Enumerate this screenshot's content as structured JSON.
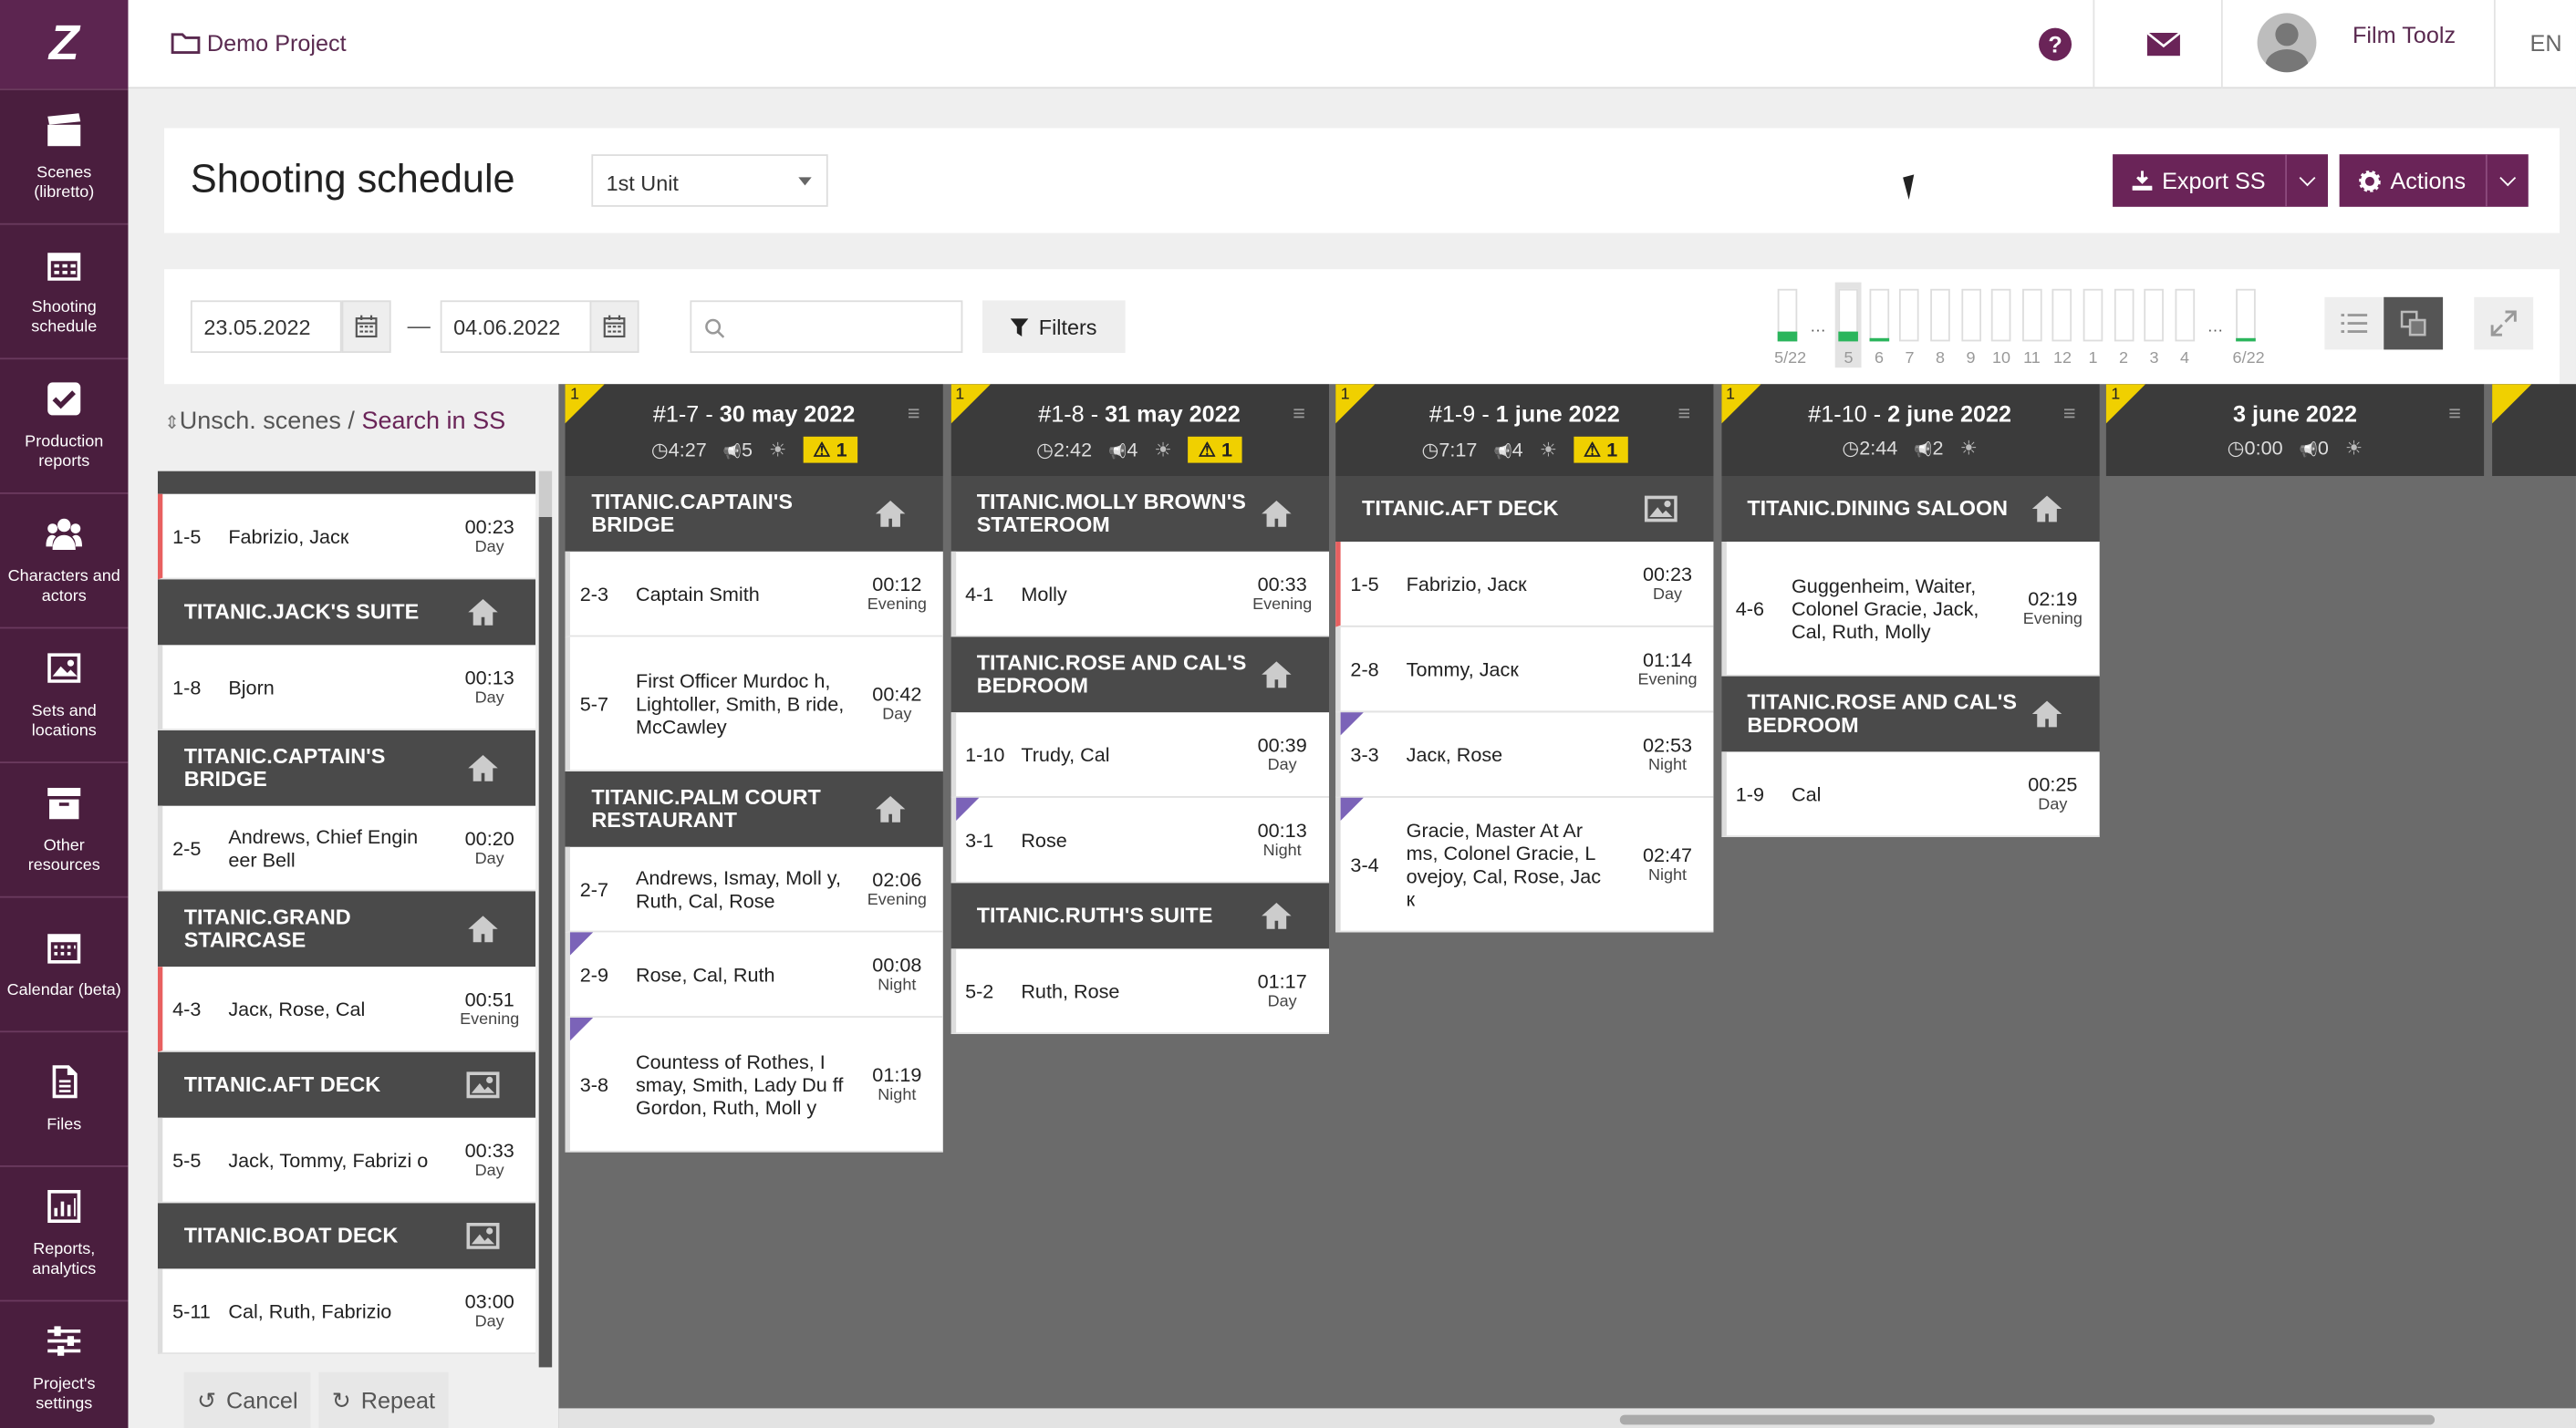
{
  "sidebar": {
    "logo": "Z",
    "items": [
      {
        "label": "Scenes (libretto)",
        "icon": "clapperboard-icon"
      },
      {
        "label": "Shooting schedule",
        "icon": "calendar-icon"
      },
      {
        "label": "Production reports",
        "icon": "checkbox-icon"
      },
      {
        "label": "Characters and actors",
        "icon": "users-icon"
      },
      {
        "label": "Sets and locations",
        "icon": "image-icon"
      },
      {
        "label": "Other resources",
        "icon": "archive-icon"
      },
      {
        "label": "Calendar (beta)",
        "icon": "calendar-grid-icon"
      },
      {
        "label": "Files",
        "icon": "file-icon"
      },
      {
        "label": "Reports, analytics",
        "icon": "chart-icon"
      },
      {
        "label": "Project's settings",
        "icon": "sliders-icon"
      }
    ]
  },
  "topbar": {
    "project": "Demo Project",
    "user_name": "Film Toolz",
    "lang": "EN"
  },
  "header": {
    "title": "Shooting schedule",
    "unit": "1st Unit",
    "export_label": "Export SS",
    "actions_label": "Actions"
  },
  "controls": {
    "date_from": "23.05.2022",
    "date_to": "04.06.2022",
    "dash": "—",
    "search_placeholder": "",
    "filters_label": "Filters",
    "days": [
      {
        "label": "5/22",
        "fill": 0.2
      },
      {
        "label": "…",
        "fill": 0
      },
      {
        "label": "5",
        "fill": 0.2,
        "selected": true
      },
      {
        "label": "6",
        "fill": 0.05
      },
      {
        "label": "7",
        "fill": 0
      },
      {
        "label": "8",
        "fill": 0
      },
      {
        "label": "9",
        "fill": 0
      },
      {
        "label": "10",
        "fill": 0
      },
      {
        "label": "11",
        "fill": 0
      },
      {
        "label": "12",
        "fill": 0
      },
      {
        "label": "1",
        "fill": 0
      },
      {
        "label": "2",
        "fill": 0
      },
      {
        "label": "3",
        "fill": 0
      },
      {
        "label": "4",
        "fill": 0
      },
      {
        "label": "…",
        "fill": 0
      },
      {
        "label": "6/22",
        "fill": 0.05
      }
    ]
  },
  "unscheduled": {
    "title": "Unsch. scenes",
    "sep": " / ",
    "link": "Search in SS",
    "groups": [
      {
        "set": "",
        "scenes": [
          {
            "num": "1-5",
            "chars": "Fabrizio, Jacк",
            "time": "00:23",
            "tod": "Day",
            "red": true
          }
        ]
      },
      {
        "set": "TITANIC.JACK'S SUITE",
        "icon": "house-icon",
        "scenes": [
          {
            "num": "1-8",
            "chars": "Bjorn",
            "time": "00:13",
            "tod": "Day"
          }
        ]
      },
      {
        "set": "TITANIC.CAPTAIN'S BRIDGE",
        "icon": "house-icon",
        "scenes": [
          {
            "num": "2-5",
            "chars": "Andrews, Chief Engin eer Bell",
            "time": "00:20",
            "tod": "Day"
          }
        ]
      },
      {
        "set": "TITANIC.GRAND STAIRCASE",
        "icon": "house-icon",
        "scenes": [
          {
            "num": "4-3",
            "chars": "Jacк, Rose, Cal",
            "time": "00:51",
            "tod": "Evening",
            "red": true
          }
        ]
      },
      {
        "set": "TITANIC.AFT DECK",
        "icon": "image-icon",
        "scenes": [
          {
            "num": "5-5",
            "chars": "Jack, Tommy, Fabrizi o",
            "time": "00:33",
            "tod": "Day"
          }
        ]
      },
      {
        "set": "TITANIC.BOAT DECK",
        "icon": "image-icon",
        "scenes": [
          {
            "num": "5-11",
            "chars": "Cal, Ruth, Fabrizio",
            "time": "03:00",
            "tod": "Day"
          }
        ]
      }
    ],
    "cancel_label": "Cancel",
    "repeat_label": "Repeat"
  },
  "schedule": [
    {
      "badge": "1",
      "id": "#1-7",
      "date": "30 may 2022",
      "dur": "4:27",
      "count": "5",
      "warn": "1",
      "groups": [
        {
          "set": "TITANIC.CAPTAIN'S BRIDGE",
          "icon": "house-icon",
          "scenes": [
            {
              "num": "2-3",
              "chars": "Captain Smith",
              "time": "00:12",
              "tod": "Evening"
            },
            {
              "num": "5-7",
              "chars": "First Officer Murdoc h, Lightoller, Smith, B ride, McCawley",
              "time": "00:42",
              "tod": "Day"
            }
          ]
        },
        {
          "set": "TITANIC.PALM COURT RESTAURANT",
          "icon": "house-icon",
          "scenes": [
            {
              "num": "2-7",
              "chars": "Andrews, Ismay, Moll y, Ruth, Cal, Rose",
              "time": "02:06",
              "tod": "Evening"
            },
            {
              "num": "2-9",
              "chars": "Rose, Cal, Ruth",
              "time": "00:08",
              "tod": "Night",
              "tri": true
            },
            {
              "num": "3-8",
              "chars": "Countess of Rothes, I smay, Smith, Lady Du ff Gordon, Ruth, Moll y",
              "time": "01:19",
              "tod": "Night",
              "tri": true
            }
          ]
        }
      ]
    },
    {
      "badge": "1",
      "id": "#1-8",
      "date": "31 may 2022",
      "dur": "2:42",
      "count": "4",
      "warn": "1",
      "groups": [
        {
          "set": "TITANIC.MOLLY BROWN'S STATEROOM",
          "icon": "house-icon",
          "scenes": [
            {
              "num": "4-1",
              "chars": "Molly",
              "time": "00:33",
              "tod": "Evening"
            }
          ]
        },
        {
          "set": "TITANIC.ROSE AND CAL'S BEDROOM",
          "icon": "house-icon",
          "scenes": [
            {
              "num": "1-10",
              "chars": "Trudy, Cal",
              "time": "00:39",
              "tod": "Day"
            },
            {
              "num": "3-1",
              "chars": "Rose",
              "time": "00:13",
              "tod": "Night",
              "tri": true
            }
          ]
        },
        {
          "set": "TITANIC.RUTH'S SUITE",
          "icon": "house-icon",
          "scenes": [
            {
              "num": "5-2",
              "chars": "Ruth, Rose",
              "time": "01:17",
              "tod": "Day"
            }
          ]
        }
      ]
    },
    {
      "badge": "1",
      "id": "#1-9",
      "date": "1 june 2022",
      "dur": "7:17",
      "count": "4",
      "warn": "1",
      "groups": [
        {
          "set": "TITANIC.AFT DECK",
          "icon": "image-icon",
          "scenes": [
            {
              "num": "1-5",
              "chars": "Fabrizio, Jacк",
              "time": "00:23",
              "tod": "Day",
              "red": true
            },
            {
              "num": "2-8",
              "chars": "Tommy, Jacк",
              "time": "01:14",
              "tod": "Evening"
            },
            {
              "num": "3-3",
              "chars": "Jacк, Rose",
              "time": "02:53",
              "tod": "Night",
              "tri": true
            },
            {
              "num": "3-4",
              "chars": "Gracie, Master At Ar ms, Colonel Gracie, L ovejoy, Cal, Rose, Jac к",
              "time": "02:47",
              "tod": "Night",
              "tri": true
            }
          ]
        }
      ]
    },
    {
      "badge": "1",
      "id": "#1-10",
      "date": "2 june 2022",
      "dur": "2:44",
      "count": "2",
      "warn": "",
      "groups": [
        {
          "set": "TITANIC.DINING SALOON",
          "icon": "house-icon",
          "scenes": [
            {
              "num": "4-6",
              "chars": "Guggenheim, Waiter, Colonel Gracie, Jack, Cal, Ruth, Molly",
              "time": "02:19",
              "tod": "Evening"
            }
          ]
        },
        {
          "set": "TITANIC.ROSE AND CAL'S BEDROOM",
          "icon": "house-icon",
          "scenes": [
            {
              "num": "1-9",
              "chars": "Cal",
              "time": "00:25",
              "tod": "Day"
            }
          ]
        }
      ]
    },
    {
      "badge": "1",
      "id": "",
      "date": "3 june 2022",
      "dur": "0:00",
      "count": "0",
      "warn": "",
      "groups": []
    }
  ]
}
